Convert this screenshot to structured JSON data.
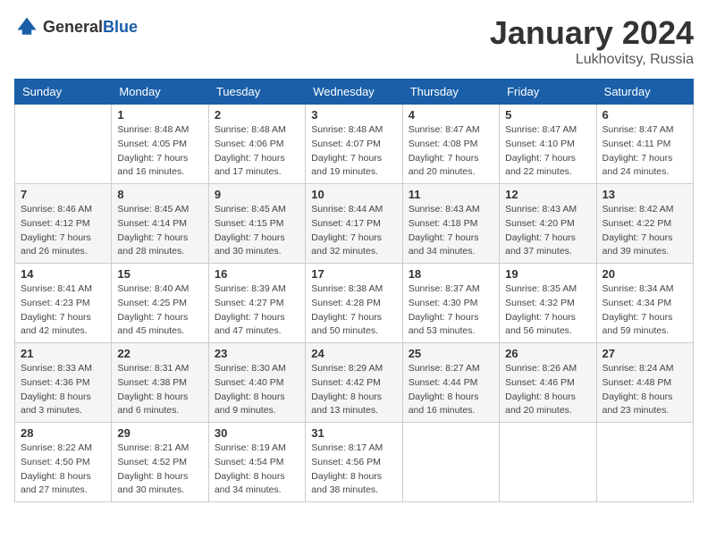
{
  "header": {
    "logo_general": "General",
    "logo_blue": "Blue",
    "month": "January 2024",
    "location": "Lukhovitsy, Russia"
  },
  "days_of_week": [
    "Sunday",
    "Monday",
    "Tuesday",
    "Wednesday",
    "Thursday",
    "Friday",
    "Saturday"
  ],
  "weeks": [
    [
      {
        "day": "",
        "info": ""
      },
      {
        "day": "1",
        "info": "Sunrise: 8:48 AM\nSunset: 4:05 PM\nDaylight: 7 hours\nand 16 minutes."
      },
      {
        "day": "2",
        "info": "Sunrise: 8:48 AM\nSunset: 4:06 PM\nDaylight: 7 hours\nand 17 minutes."
      },
      {
        "day": "3",
        "info": "Sunrise: 8:48 AM\nSunset: 4:07 PM\nDaylight: 7 hours\nand 19 minutes."
      },
      {
        "day": "4",
        "info": "Sunrise: 8:47 AM\nSunset: 4:08 PM\nDaylight: 7 hours\nand 20 minutes."
      },
      {
        "day": "5",
        "info": "Sunrise: 8:47 AM\nSunset: 4:10 PM\nDaylight: 7 hours\nand 22 minutes."
      },
      {
        "day": "6",
        "info": "Sunrise: 8:47 AM\nSunset: 4:11 PM\nDaylight: 7 hours\nand 24 minutes."
      }
    ],
    [
      {
        "day": "7",
        "info": "Sunrise: 8:46 AM\nSunset: 4:12 PM\nDaylight: 7 hours\nand 26 minutes."
      },
      {
        "day": "8",
        "info": "Sunrise: 8:45 AM\nSunset: 4:14 PM\nDaylight: 7 hours\nand 28 minutes."
      },
      {
        "day": "9",
        "info": "Sunrise: 8:45 AM\nSunset: 4:15 PM\nDaylight: 7 hours\nand 30 minutes."
      },
      {
        "day": "10",
        "info": "Sunrise: 8:44 AM\nSunset: 4:17 PM\nDaylight: 7 hours\nand 32 minutes."
      },
      {
        "day": "11",
        "info": "Sunrise: 8:43 AM\nSunset: 4:18 PM\nDaylight: 7 hours\nand 34 minutes."
      },
      {
        "day": "12",
        "info": "Sunrise: 8:43 AM\nSunset: 4:20 PM\nDaylight: 7 hours\nand 37 minutes."
      },
      {
        "day": "13",
        "info": "Sunrise: 8:42 AM\nSunset: 4:22 PM\nDaylight: 7 hours\nand 39 minutes."
      }
    ],
    [
      {
        "day": "14",
        "info": "Sunrise: 8:41 AM\nSunset: 4:23 PM\nDaylight: 7 hours\nand 42 minutes."
      },
      {
        "day": "15",
        "info": "Sunrise: 8:40 AM\nSunset: 4:25 PM\nDaylight: 7 hours\nand 45 minutes."
      },
      {
        "day": "16",
        "info": "Sunrise: 8:39 AM\nSunset: 4:27 PM\nDaylight: 7 hours\nand 47 minutes."
      },
      {
        "day": "17",
        "info": "Sunrise: 8:38 AM\nSunset: 4:28 PM\nDaylight: 7 hours\nand 50 minutes."
      },
      {
        "day": "18",
        "info": "Sunrise: 8:37 AM\nSunset: 4:30 PM\nDaylight: 7 hours\nand 53 minutes."
      },
      {
        "day": "19",
        "info": "Sunrise: 8:35 AM\nSunset: 4:32 PM\nDaylight: 7 hours\nand 56 minutes."
      },
      {
        "day": "20",
        "info": "Sunrise: 8:34 AM\nSunset: 4:34 PM\nDaylight: 7 hours\nand 59 minutes."
      }
    ],
    [
      {
        "day": "21",
        "info": "Sunrise: 8:33 AM\nSunset: 4:36 PM\nDaylight: 8 hours\nand 3 minutes."
      },
      {
        "day": "22",
        "info": "Sunrise: 8:31 AM\nSunset: 4:38 PM\nDaylight: 8 hours\nand 6 minutes."
      },
      {
        "day": "23",
        "info": "Sunrise: 8:30 AM\nSunset: 4:40 PM\nDaylight: 8 hours\nand 9 minutes."
      },
      {
        "day": "24",
        "info": "Sunrise: 8:29 AM\nSunset: 4:42 PM\nDaylight: 8 hours\nand 13 minutes."
      },
      {
        "day": "25",
        "info": "Sunrise: 8:27 AM\nSunset: 4:44 PM\nDaylight: 8 hours\nand 16 minutes."
      },
      {
        "day": "26",
        "info": "Sunrise: 8:26 AM\nSunset: 4:46 PM\nDaylight: 8 hours\nand 20 minutes."
      },
      {
        "day": "27",
        "info": "Sunrise: 8:24 AM\nSunset: 4:48 PM\nDaylight: 8 hours\nand 23 minutes."
      }
    ],
    [
      {
        "day": "28",
        "info": "Sunrise: 8:22 AM\nSunset: 4:50 PM\nDaylight: 8 hours\nand 27 minutes."
      },
      {
        "day": "29",
        "info": "Sunrise: 8:21 AM\nSunset: 4:52 PM\nDaylight: 8 hours\nand 30 minutes."
      },
      {
        "day": "30",
        "info": "Sunrise: 8:19 AM\nSunset: 4:54 PM\nDaylight: 8 hours\nand 34 minutes."
      },
      {
        "day": "31",
        "info": "Sunrise: 8:17 AM\nSunset: 4:56 PM\nDaylight: 8 hours\nand 38 minutes."
      },
      {
        "day": "",
        "info": ""
      },
      {
        "day": "",
        "info": ""
      },
      {
        "day": "",
        "info": ""
      }
    ]
  ]
}
